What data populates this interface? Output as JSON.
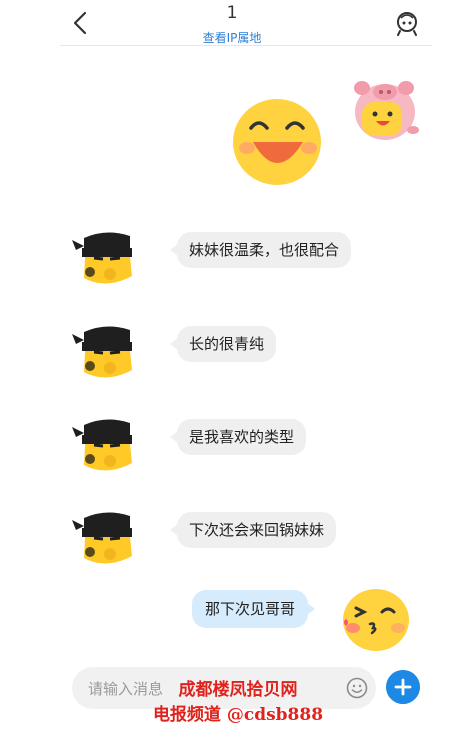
{
  "header": {
    "title": "1",
    "ip_link": "查看IP属地",
    "back_icon": "chevron-left-icon",
    "settings_icon": "robot-face-icon"
  },
  "stickers": {
    "pig_avatar": "pig-hood-avatar",
    "laugh_emoji": "big-laughing-emoji",
    "ninja_avatar": "masked-ninja-avatar",
    "kiss_emoji": "wink-kiss-emoji"
  },
  "messages": [
    {
      "side": "left",
      "text": "妹妹很温柔，也很配合"
    },
    {
      "side": "left",
      "text": "长的很青纯"
    },
    {
      "side": "left",
      "text": "是我喜欢的类型"
    },
    {
      "side": "left",
      "text": "下次还会来回锅妹妹"
    },
    {
      "side": "right",
      "text": "那下次见哥哥"
    }
  ],
  "composer": {
    "placeholder": "请输入消息",
    "emoji_icon": "smiley-icon",
    "plus_icon": "plus-icon"
  },
  "watermark": {
    "line1": "成都楼凤拾贝网",
    "line2": "电报频道 @cdsb888"
  },
  "colors": {
    "link": "#2f7fd6",
    "left_bubble": "#efefef",
    "right_bubble": "#d6ebfb",
    "accent": "#1e88e5",
    "watermark": "#e0221c"
  }
}
